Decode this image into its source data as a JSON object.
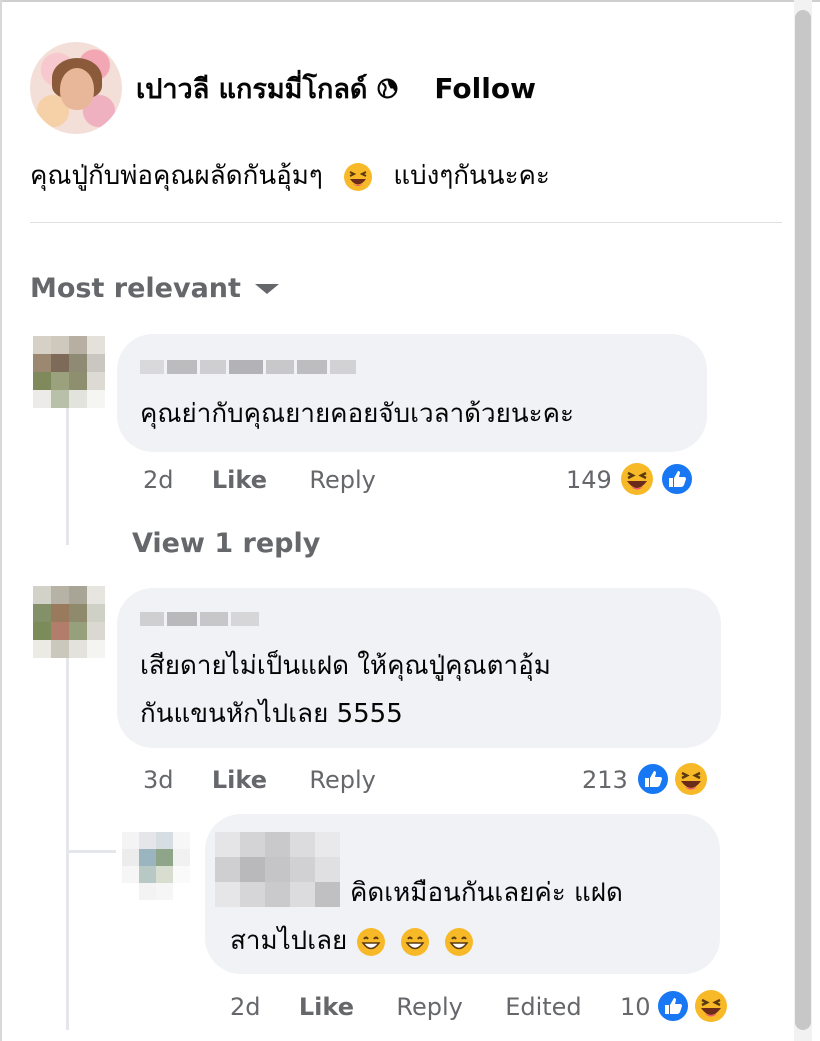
{
  "post": {
    "author_name": "เปาวลี แกรมมี่โกลด์",
    "follow_label": "Follow",
    "text_before_emoji": "คุณปู่กับพ่อคุณผลัดกันอุ้มๆ",
    "text_after_emoji": "แบ่งๆกันนะคะ",
    "privacy_icon": "globe-icon",
    "emoji": "grinning-squinting-face"
  },
  "comments": {
    "sort_label": "Most relevant",
    "items": [
      {
        "text": "คุณย่ากับคุณยายคอยจับเวลาด้วยนะคะ",
        "time": "2d",
        "like_label": "Like",
        "reply_label": "Reply",
        "reaction_count": "149",
        "reactions": [
          "haha",
          "like"
        ],
        "view_replies_label": "View 1 reply"
      },
      {
        "text_line1": "เสียดายไม่เป็นแฝด ให้คุณปู่คุณตาอุ้ม",
        "text_line2": "กันแขนหักไปเลย 5555",
        "time": "3d",
        "like_label": "Like",
        "reply_label": "Reply",
        "reaction_count": "213",
        "reactions": [
          "like",
          "haha"
        ]
      }
    ],
    "reply": {
      "text_line1": "คิดเหมือนกันเลยค่ะ แฝด",
      "text_line2": "สามไปเลย",
      "emojis": [
        "beaming-face",
        "beaming-face",
        "beaming-face"
      ],
      "time": "2d",
      "like_label": "Like",
      "reply_label": "Reply",
      "edited_label": "Edited",
      "reaction_count": "10",
      "reactions": [
        "like",
        "haha"
      ]
    }
  },
  "colors": {
    "secondary_text": "#65676b",
    "bubble_bg": "#f0f2f5",
    "like_blue": "#1877f2",
    "haha_yellow": "#f7b928"
  }
}
